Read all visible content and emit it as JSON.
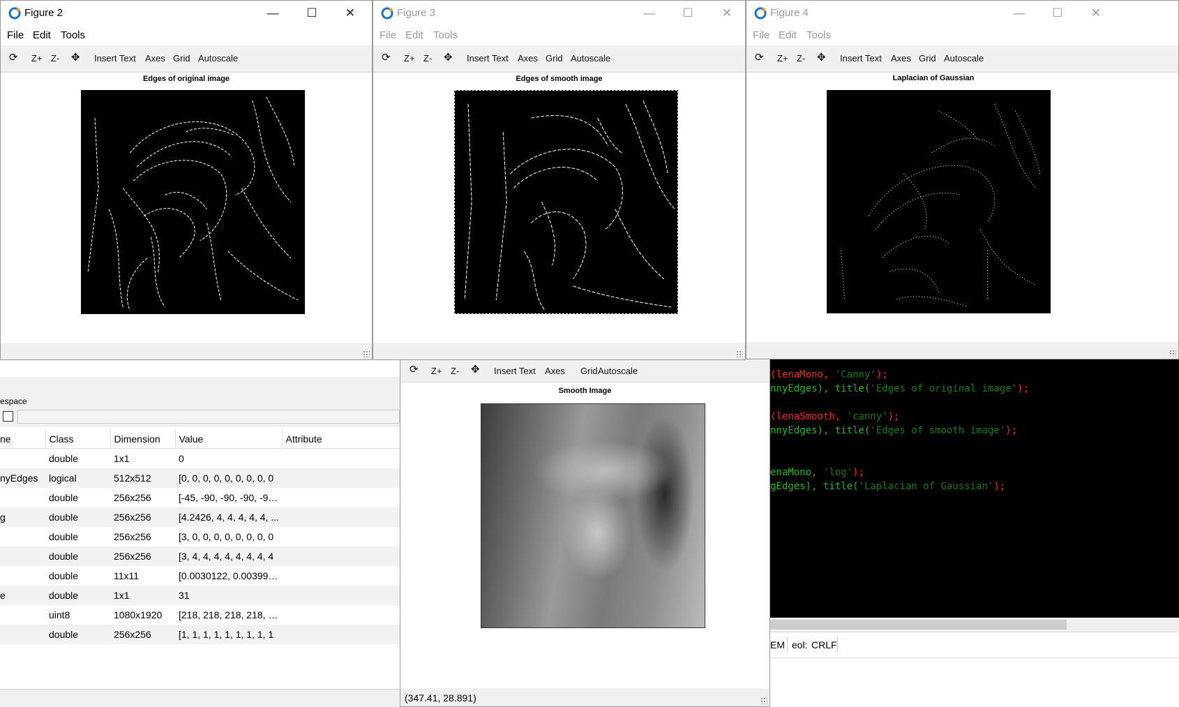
{
  "figure2": {
    "title": "Figure 2",
    "menu": [
      "File",
      "Edit",
      "Tools"
    ],
    "toolbar": {
      "zoom_in": "Z+",
      "zoom_out": "Z-",
      "insert_text": "Insert Text",
      "axes": "Axes",
      "grid": "Grid",
      "autoscale": "Autoscale"
    },
    "plot_title": "Edges of original image"
  },
  "figure3": {
    "title": "Figure 3",
    "menu": [
      "File",
      "Edit",
      "Tools"
    ],
    "toolbar": {
      "zoom_in": "Z+",
      "zoom_out": "Z-",
      "insert_text": "Insert Text",
      "axes": "Axes",
      "grid": "Grid",
      "autoscale": "Autoscale"
    },
    "plot_title": "Edges of smooth image"
  },
  "figure4": {
    "title": "Figure 4",
    "menu": [
      "File",
      "Edit",
      "Tools"
    ],
    "toolbar": {
      "zoom_in": "Z+",
      "zoom_out": "Z-",
      "insert_text": "Insert Text",
      "axes": "Axes",
      "grid": "Grid",
      "autoscale": "Autoscale"
    },
    "plot_title": "Laplacian of Gaussian"
  },
  "figure1": {
    "toolbar": {
      "zoom_in": "Z+",
      "zoom_out": "Z-",
      "insert_text": "Insert Text",
      "axes": "Axes",
      "grid": "Grid",
      "autoscale": "Autoscale"
    },
    "plot_title": "Smooth Image",
    "status": "(347.41, 28.891)"
  },
  "workspace": {
    "label": "espace",
    "columns": {
      "name": "ne",
      "class": "Class",
      "dimension": "Dimension",
      "value": "Value",
      "attribute": "Attribute"
    },
    "rows": [
      {
        "name": "",
        "class": "double",
        "dimension": "1x1",
        "value": "0"
      },
      {
        "name": "nyEdges",
        "class": "logical",
        "dimension": "512x512",
        "value": "[0, 0, 0, 0, 0, 0, 0, 0, 0"
      },
      {
        "name": "",
        "class": "double",
        "dimension": "256x256",
        "value": "[-45, -90, -90, -90, -90,..."
      },
      {
        "name": "g",
        "class": "double",
        "dimension": "256x256",
        "value": "[4.2426, 4, 4, 4, 4, 4, ..."
      },
      {
        "name": "",
        "class": "double",
        "dimension": "256x256",
        "value": "[3, 0, 0, 0, 0, 0, 0, 0, 0"
      },
      {
        "name": "",
        "class": "double",
        "dimension": "256x256",
        "value": "[3, 4, 4, 4, 4, 4, 4, 4, 4"
      },
      {
        "name": "",
        "class": "double",
        "dimension": "11x11",
        "value": "[0.0030122, 0.0039906..."
      },
      {
        "name": "e",
        "class": "double",
        "dimension": "1x1",
        "value": "31"
      },
      {
        "name": "",
        "class": "uint8",
        "dimension": "1080x1920",
        "value": "[218, 218, 218, 218, 21..."
      },
      {
        "name": "",
        "class": "double",
        "dimension": "256x256",
        "value": "[1, 1, 1, 1, 1, 1, 1, 1, 1"
      }
    ]
  },
  "console": {
    "lines": [
      {
        "a": "(lenaMono, ",
        "s": "'Canny'",
        "b": ");"
      },
      {
        "a": "nnyEdges), title(",
        "s": "'Edges of original image'",
        "b": ");"
      },
      {
        "a": "",
        "s": "",
        "b": ""
      },
      {
        "a": "(lenaSmooth, ",
        "s": "'canny'",
        "b": ");"
      },
      {
        "a": "nnyEdges), title(",
        "s": "'Edges of smooth image'",
        "b": ");"
      },
      {
        "a": "",
        "s": "",
        "b": ""
      },
      {
        "a": "",
        "s": "",
        "b": ""
      },
      {
        "a": "enaMono, ",
        "s": "'log'",
        "b": ");"
      },
      {
        "a": "gEdges), title(",
        "s": "'Laplacian of Gaussian'",
        "b": ");"
      }
    ]
  },
  "editor_status": {
    "encoding": "EM",
    "eol_label": "eol:",
    "eol_value": "CRLF"
  },
  "colors": {
    "console_bg": "#000000",
    "code_text": "#1fb31f",
    "string": "#0e7a0e",
    "paren": "#ff1f1f",
    "app_icon": "#1a73c8"
  }
}
